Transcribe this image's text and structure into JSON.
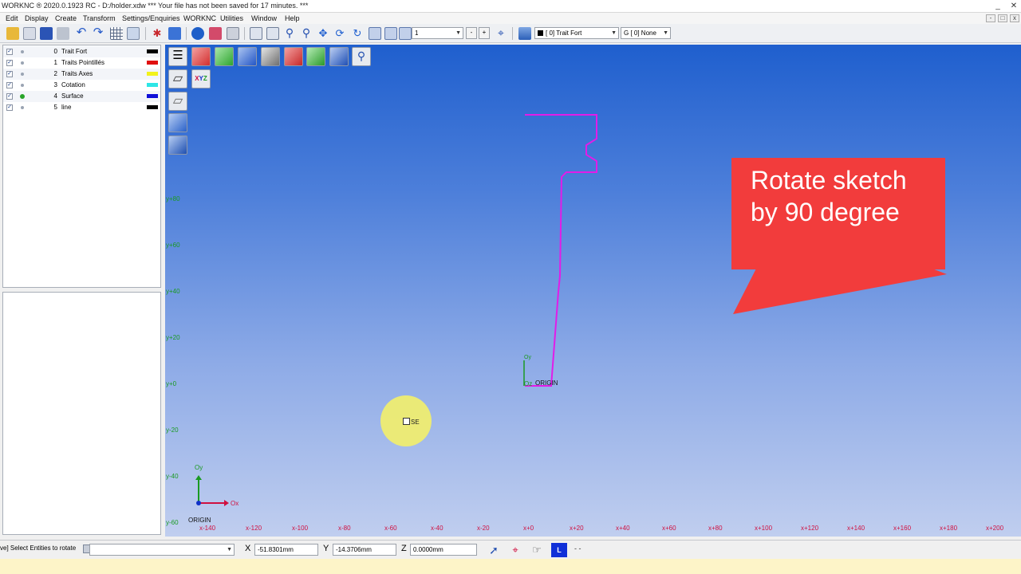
{
  "window": {
    "title": "WORKNC ® 2020.0.1923 RC - D:/holder.xdw *** Your file has not been saved for 17 minutes. ***",
    "minimize": "_",
    "close": "✕"
  },
  "menu": [
    "Edit",
    "Display",
    "Create",
    "Transform",
    "Settings/Enquiries",
    "WORKNC",
    "Utilities",
    "Window",
    "Help"
  ],
  "toolbar": {
    "count_value": "1",
    "minus_label": "-",
    "plus_label": "+",
    "layer_combo": "[  0] Trait Fort",
    "group_combo": "G [  0] None"
  },
  "layers": [
    {
      "num": "0",
      "name": "Trait Fort",
      "color": "#000000",
      "checked": true,
      "active": false
    },
    {
      "num": "1",
      "name": "Traits Pointillés",
      "color": "#e01010",
      "checked": true,
      "active": false
    },
    {
      "num": "2",
      "name": "Traits Axes",
      "color": "#f2f21a",
      "checked": true,
      "active": false
    },
    {
      "num": "3",
      "name": "Cotation",
      "color": "#2de6e6",
      "checked": true,
      "active": false
    },
    {
      "num": "4",
      "name": "Surface",
      "color": "#1010d8",
      "checked": true,
      "active": true
    },
    {
      "num": "5",
      "name": "line",
      "color": "#000000",
      "checked": true,
      "active": false
    }
  ],
  "viewport": {
    "x_ticks": [
      "x-140",
      "x-120",
      "x-100",
      "x-80",
      "x-60",
      "x-40",
      "x-20",
      "x+0",
      "x+20",
      "x+40",
      "x+60",
      "x+80",
      "x+100",
      "x+120",
      "x+140",
      "x+160",
      "x+180",
      "x+200"
    ],
    "y_ticks": [
      "y+80",
      "y+60",
      "y+40",
      "y+20",
      "y+0",
      "y-20",
      "y-40",
      "y-60"
    ],
    "origin_label": "ORIGIN",
    "oz_label": "Oz",
    "oy_label": "Oy",
    "corner_oy": "Oy",
    "corner_ox": "Ox",
    "corner_origin": "ORIGIN",
    "callout": "Rotate sketch\nby 90 degree",
    "cursor_label": "SE",
    "sketch_color": "#e21ce8",
    "callout_color": "#f23c3c"
  },
  "status": {
    "prompt": "ve] Select Entities to rotate",
    "x_label": "X",
    "x_value": "-51.8301mm",
    "y_label": "Y",
    "y_value": "-14.3706mm",
    "z_label": "Z",
    "z_value": "0.0000mm",
    "mode_label": "L",
    "dash_label": "- -"
  }
}
